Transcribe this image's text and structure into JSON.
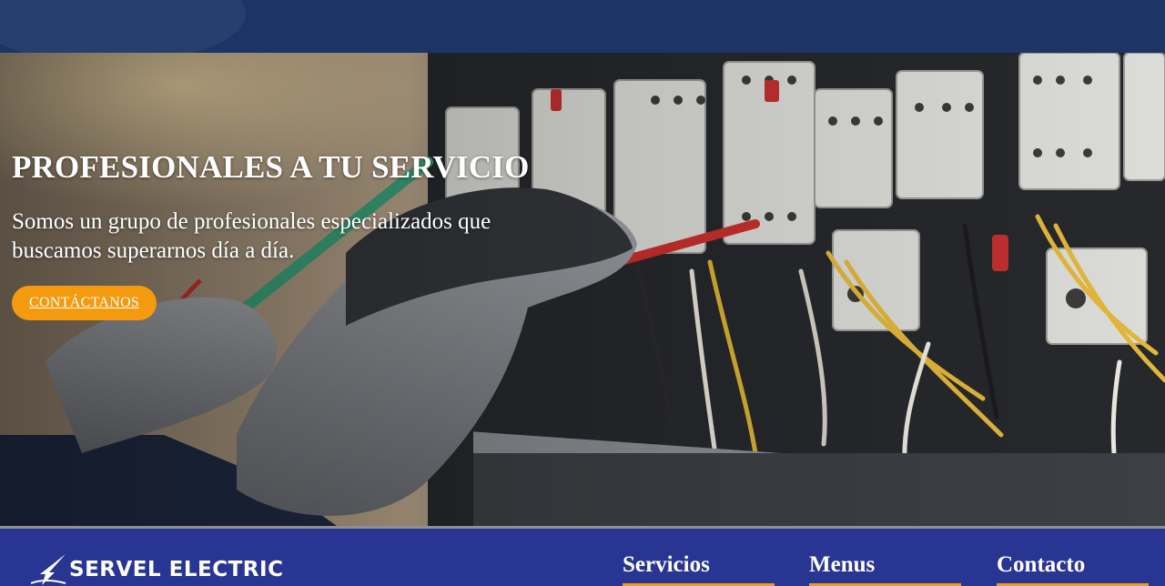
{
  "hero": {
    "title": "PROFESIONALES A TU SERVICIO",
    "subtitle": "Somos un grupo de profesionales especializados que buscamos superarnos día a día.",
    "cta_label": "CONTÁCTANOS",
    "image_alt": "electrician-testing-switchboard-photo"
  },
  "footer": {
    "logo_text": "SERVEL ELECTRIC",
    "headings": [
      "Servicios",
      "Menus",
      "Contacto"
    ]
  },
  "colors": {
    "header_bg": "#1b3566",
    "footer_bg": "#283593",
    "accent": "#f39a0f",
    "divider": "#8f8f93"
  }
}
